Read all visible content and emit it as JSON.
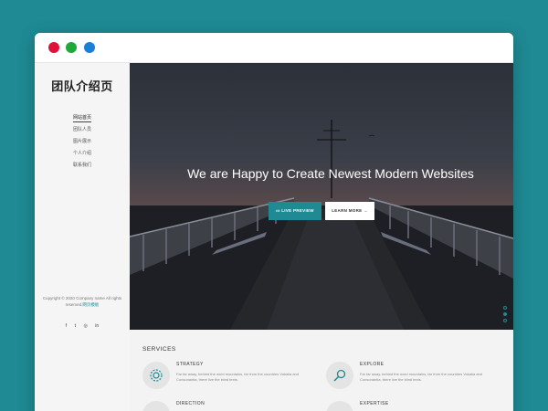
{
  "window": {
    "dots": [
      "red",
      "green",
      "blue"
    ]
  },
  "sidebar": {
    "brand": "团队介绍页",
    "nav": [
      {
        "label": "网站首页"
      },
      {
        "label": "团队人员"
      },
      {
        "label": "图片展示"
      },
      {
        "label": "个人介绍"
      },
      {
        "label": "联系我们"
      }
    ],
    "copyright_text": "Copyright © 2020 Company name All rights reserved.",
    "copyright_link": "网页模板",
    "social_icons": [
      "facebook-icon",
      "twitter-icon",
      "instagram-icon",
      "linkedin-icon"
    ],
    "social_glyphs": [
      "f",
      "t",
      "◎",
      "in"
    ]
  },
  "hero": {
    "title": "We are Happy to Create Newest Modern Websites",
    "live_preview": "LIVE PREVIEW",
    "learn_more": "LEARN MORE"
  },
  "services": {
    "title": "SERVICES",
    "items": [
      {
        "name": "STRATEGY",
        "icon": "gear-icon",
        "desc": "Far far away, behind the word mountains, far from the countries Vokalia and Consonantia, there live the blind texts."
      },
      {
        "name": "EXPLORE",
        "icon": "search-icon",
        "desc": "Far far away, behind the word mountains, far from the countries Vokalia and Consonantia, there live the blind texts."
      },
      {
        "name": "DIRECTION",
        "icon": "compass-icon",
        "desc": ""
      },
      {
        "name": "EXPERTISE",
        "icon": "star-icon",
        "desc": ""
      }
    ]
  },
  "colors": {
    "background": "#1f8a94",
    "accent": "#1f8a94"
  }
}
